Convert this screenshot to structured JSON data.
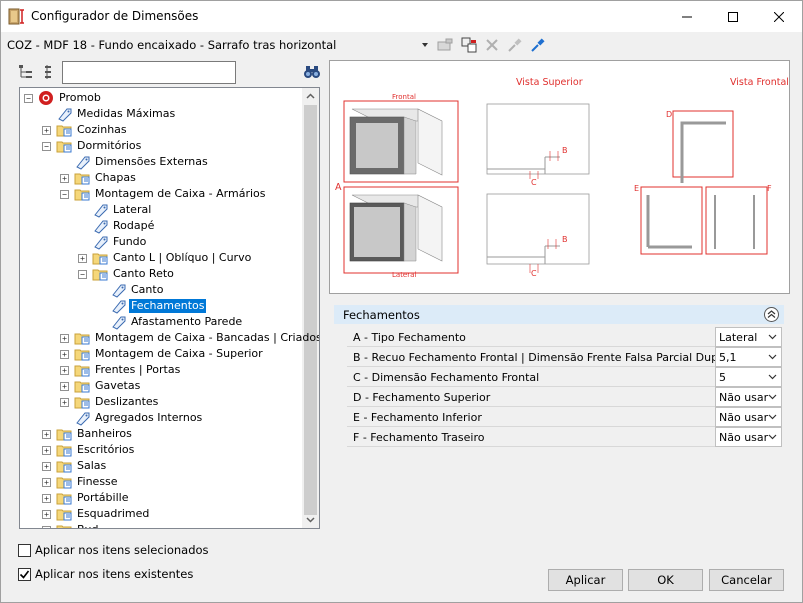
{
  "window": {
    "title": "Configurador de Dimensões"
  },
  "path": {
    "text": "COZ - MDF 18 - Fundo encaixado - Sarrafo tras horizontal"
  },
  "search": {
    "value": "",
    "placeholder": ""
  },
  "tree": {
    "items": [
      {
        "label": "Promob",
        "level": 0,
        "expander": "-",
        "icon": "promob-icon"
      },
      {
        "label": "Medidas Máximas",
        "level": 1,
        "expander": "",
        "icon": "tag-icon"
      },
      {
        "label": "Cozinhas",
        "level": 1,
        "expander": "+",
        "icon": "folder-icon"
      },
      {
        "label": "Dormitórios",
        "level": 1,
        "expander": "-",
        "icon": "folder-icon"
      },
      {
        "label": "Dimensões Externas",
        "level": 2,
        "expander": "",
        "icon": "tag-icon"
      },
      {
        "label": "Chapas",
        "level": 2,
        "expander": "+",
        "icon": "folder-icon"
      },
      {
        "label": "Montagem de Caixa - Armários",
        "level": 2,
        "expander": "-",
        "icon": "folder-icon"
      },
      {
        "label": "Lateral",
        "level": 3,
        "expander": "",
        "icon": "tag-icon"
      },
      {
        "label": "Rodapé",
        "level": 3,
        "expander": "",
        "icon": "tag-icon"
      },
      {
        "label": "Fundo",
        "level": 3,
        "expander": "",
        "icon": "tag-icon"
      },
      {
        "label": "Canto L | Oblíquo | Curvo",
        "level": 3,
        "expander": "+",
        "icon": "folder-icon"
      },
      {
        "label": "Canto Reto",
        "level": 3,
        "expander": "-",
        "icon": "folder-icon"
      },
      {
        "label": "Canto",
        "level": 4,
        "expander": "",
        "icon": "tag-icon"
      },
      {
        "label": "Fechamentos",
        "level": 4,
        "expander": "",
        "icon": "tag-icon",
        "selected": true
      },
      {
        "label": "Afastamento Parede",
        "level": 4,
        "expander": "",
        "icon": "tag-icon"
      },
      {
        "label": "Montagem de Caixa - Bancadas | Criados",
        "level": 2,
        "expander": "+",
        "icon": "folder-icon"
      },
      {
        "label": "Montagem de Caixa - Superior",
        "level": 2,
        "expander": "+",
        "icon": "folder-icon"
      },
      {
        "label": "Frentes | Portas",
        "level": 2,
        "expander": "+",
        "icon": "folder-icon"
      },
      {
        "label": "Gavetas",
        "level": 2,
        "expander": "+",
        "icon": "folder-icon"
      },
      {
        "label": "Deslizantes",
        "level": 2,
        "expander": "+",
        "icon": "folder-icon"
      },
      {
        "label": "Agregados Internos",
        "level": 2,
        "expander": "",
        "icon": "tag-icon"
      },
      {
        "label": "Banheiros",
        "level": 1,
        "expander": "+",
        "icon": "folder-icon"
      },
      {
        "label": "Escritórios",
        "level": 1,
        "expander": "+",
        "icon": "folder-icon"
      },
      {
        "label": "Salas",
        "level": 1,
        "expander": "+",
        "icon": "folder-icon"
      },
      {
        "label": "Finesse",
        "level": 1,
        "expander": "+",
        "icon": "folder-icon"
      },
      {
        "label": "Portábille",
        "level": 1,
        "expander": "+",
        "icon": "folder-icon"
      },
      {
        "label": "Esquadrimed",
        "level": 1,
        "expander": "+",
        "icon": "folder-icon"
      },
      {
        "label": "Bud...",
        "level": 1,
        "expander": "+",
        "icon": "folder-icon"
      }
    ]
  },
  "preview": {
    "labels": {
      "vista_superior": "Vista Superior",
      "vista_frontal": "Vista Frontal",
      "frontal": "Frontal",
      "lateral": "Lateral",
      "a": "A",
      "b1": "B",
      "c1": "C",
      "b2": "B",
      "c2": "C",
      "d": "D",
      "e": "E",
      "f": "F"
    },
    "accent": "#e0302e"
  },
  "properties": {
    "header": "Fechamentos",
    "rows": [
      {
        "name": "A - Tipo Fechamento",
        "value": "Lateral"
      },
      {
        "name": "B - Recuo Fechamento Frontal | Dimensão Frente Falsa Parcial Dupla",
        "value": "5,1"
      },
      {
        "name": "C - Dimensão Fechamento Frontal",
        "value": "5"
      },
      {
        "name": "D - Fechamento Superior",
        "value": "Não usar"
      },
      {
        "name": "E - Fechamento Inferior",
        "value": "Não usar"
      },
      {
        "name": "F - Fechamento Traseiro",
        "value": "Não usar"
      }
    ]
  },
  "options": {
    "apply_selected": {
      "label": "Aplicar nos itens selecionados",
      "checked": false
    },
    "apply_existing": {
      "label": "Aplicar nos itens existentes",
      "checked": true
    }
  },
  "buttons": {
    "apply": "Aplicar",
    "ok": "OK",
    "cancel": "Cancelar"
  }
}
